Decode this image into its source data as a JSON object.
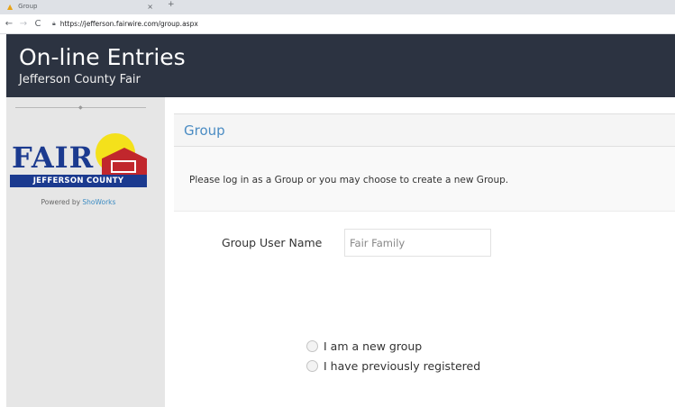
{
  "browser": {
    "tab_title": "Group",
    "tab_close": "×",
    "new_tab": "+",
    "url": "https://jefferson.fairwire.com/group.aspx"
  },
  "header": {
    "title": "On-line Entries",
    "subtitle": "Jefferson County Fair"
  },
  "sidebar": {
    "logo_word": "FAIR",
    "logo_county": "JEFFERSON COUNTY",
    "powered_prefix": "Powered by",
    "powered_link": "ShoWorks"
  },
  "panel": {
    "title": "Group",
    "message": "Please log in as a Group or you may choose to create a new Group."
  },
  "form": {
    "username_label": "Group User Name",
    "username_value": "Fair Family",
    "options": [
      {
        "label": "I am a new group",
        "selected": false
      },
      {
        "label": "I have previously registered",
        "selected": false
      }
    ]
  },
  "colors": {
    "header_bg": "#2c3341",
    "accent": "#4b8cc3",
    "logo_blue": "#1b3a8f",
    "logo_red": "#c1272d",
    "logo_yellow": "#f4e11b"
  }
}
